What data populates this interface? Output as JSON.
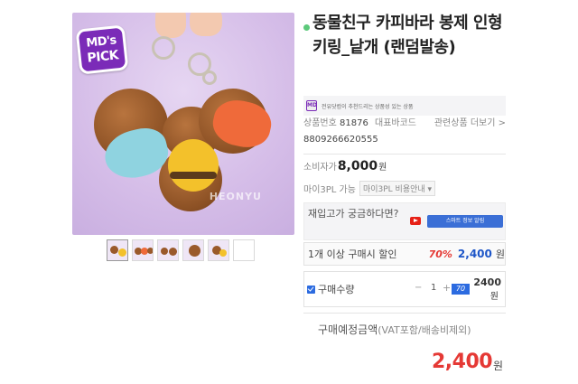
{
  "product": {
    "title": "동물친구 카피바라 봉제 인형 키링_낱개 (랜덤발송)",
    "badge_line1": "MD's",
    "badge_line2": "PICK",
    "watermark": "HEONYU"
  },
  "recommend": {
    "icon_text": "MD",
    "text": "전유닷컴이 추천드리는 상품성 있는 상품"
  },
  "codes": {
    "product_no_label": "상품번호",
    "product_no": "81876",
    "barcode_label": "대표바코드",
    "barcode": "8809266620555",
    "related_link": "관련상품 더보기 >"
  },
  "price": {
    "consumer_label": "소비자가",
    "consumer_price": "8,000",
    "won": "원"
  },
  "my3pl": {
    "label": "마이3PL 가능",
    "guide": "마이3PL 비용안내 ▾"
  },
  "restock": {
    "question": "재입고가 궁금하다면?",
    "smart_button": "스마트 정보 알림"
  },
  "discount": {
    "label": "1개 이상 구매시 할인",
    "rate": "70%",
    "price": "2,400",
    "won": "원"
  },
  "quantity": {
    "label": "구매수량",
    "minus": "−",
    "value": "1",
    "plus": "+",
    "tag": "70",
    "total": "2400",
    "won": "원"
  },
  "expected": {
    "label": "구매예정금액",
    "sub": "(VAT포함/배송비제외)",
    "price": "2,400",
    "won": "원"
  },
  "colors": {
    "accent_red": "#e53935",
    "accent_blue": "#1e56c8",
    "badge_purple": "#7b2bb8",
    "dot_green": "#5cc97a"
  },
  "icons": [
    "youtube-icon",
    "checkbox-icon",
    "md-pick-badge"
  ]
}
